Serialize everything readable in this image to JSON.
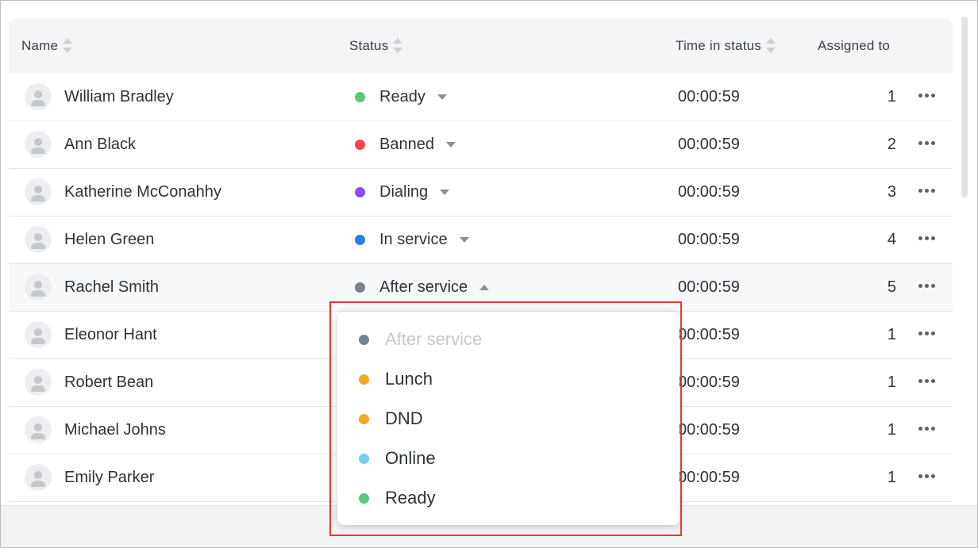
{
  "columns": {
    "name": "Name",
    "status": "Status",
    "time_in_status": "Time in status",
    "assigned_to": "Assigned to"
  },
  "rows": [
    {
      "name": "William Bradley",
      "status": "Ready",
      "status_color": "#5ac87c",
      "time": "00:00:59",
      "assigned": "1",
      "open": false
    },
    {
      "name": "Ann Black",
      "status": "Banned",
      "status_color": "#f2474a",
      "time": "00:00:59",
      "assigned": "2",
      "open": false
    },
    {
      "name": "Katherine McConahhy",
      "status": "Dialing",
      "status_color": "#8c4ef2",
      "time": "00:00:59",
      "assigned": "3",
      "open": false
    },
    {
      "name": "Helen Green",
      "status": "In service",
      "status_color": "#2d7af2",
      "time": "00:00:59",
      "assigned": "4",
      "open": false
    },
    {
      "name": "Rachel Smith",
      "status": "After service",
      "status_color": "#77838c",
      "time": "00:00:59",
      "assigned": "5",
      "open": true
    },
    {
      "name": "Eleonor Hant",
      "status": "",
      "status_color": "",
      "time": "00:00:59",
      "assigned": "1",
      "open": false
    },
    {
      "name": "Robert Bean",
      "status": "",
      "status_color": "",
      "time": "00:00:59",
      "assigned": "1",
      "open": false
    },
    {
      "name": "Michael Johns",
      "status": "",
      "status_color": "",
      "time": "00:00:59",
      "assigned": "1",
      "open": false
    },
    {
      "name": "Emily Parker",
      "status": "",
      "status_color": "",
      "time": "00:00:59",
      "assigned": "1",
      "open": false
    }
  ],
  "status_dropdown": {
    "options": [
      {
        "label": "After service",
        "color": "#77838c",
        "disabled": true
      },
      {
        "label": "Lunch",
        "color": "#f2a91e",
        "disabled": false
      },
      {
        "label": "DND",
        "color": "#f2a91e",
        "disabled": false
      },
      {
        "label": "Online",
        "color": "#6fd0f2",
        "disabled": false
      },
      {
        "label": "Ready",
        "color": "#5ac87c",
        "disabled": false
      }
    ]
  },
  "icons": {
    "avatar": "user-avatar-icon",
    "more": "more-horizontal-icon",
    "sort": "sort-icon",
    "caret_down": "caret-down-icon",
    "caret_up": "caret-up-icon"
  }
}
